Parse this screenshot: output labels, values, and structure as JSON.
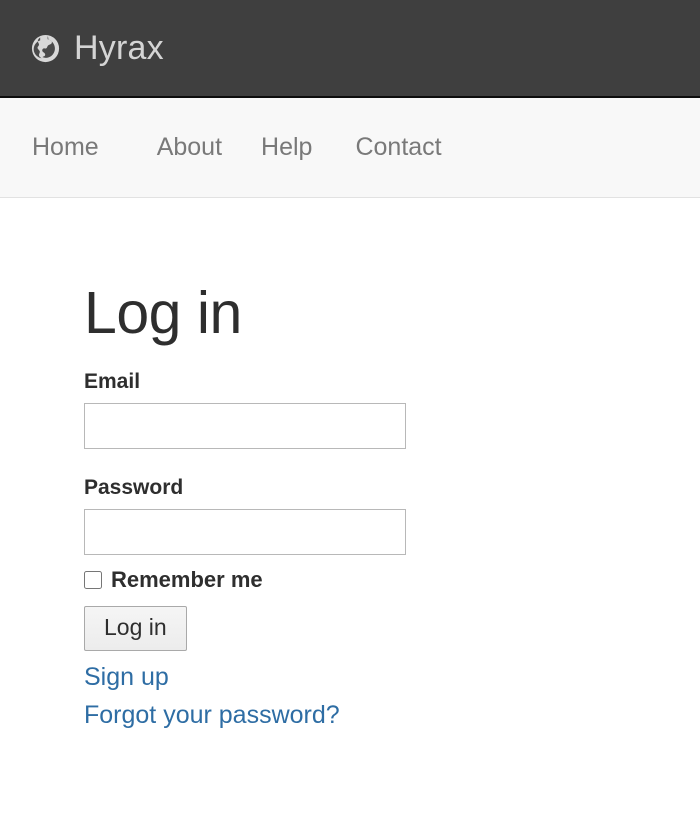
{
  "masthead": {
    "brand_name": "Hyrax",
    "brand_icon": "globe-icon",
    "background_color": "#3f3f3f",
    "text_color": "#d4d4d4"
  },
  "navbar": {
    "background_color": "#f8f8f8",
    "link_color": "#797979",
    "items": [
      {
        "label": "Home"
      },
      {
        "label": "About"
      },
      {
        "label": "Help"
      },
      {
        "label": "Contact"
      }
    ]
  },
  "main": {
    "page_title": "Log in",
    "form": {
      "email": {
        "label": "Email",
        "value": "",
        "placeholder": ""
      },
      "password": {
        "label": "Password",
        "value": "",
        "placeholder": ""
      },
      "remember_me": {
        "label": "Remember me",
        "checked": false
      },
      "submit_label": "Log in"
    },
    "links": [
      {
        "label": "Sign up"
      },
      {
        "label": "Forgot your password?"
      }
    ],
    "link_color": "#2e6da4"
  }
}
